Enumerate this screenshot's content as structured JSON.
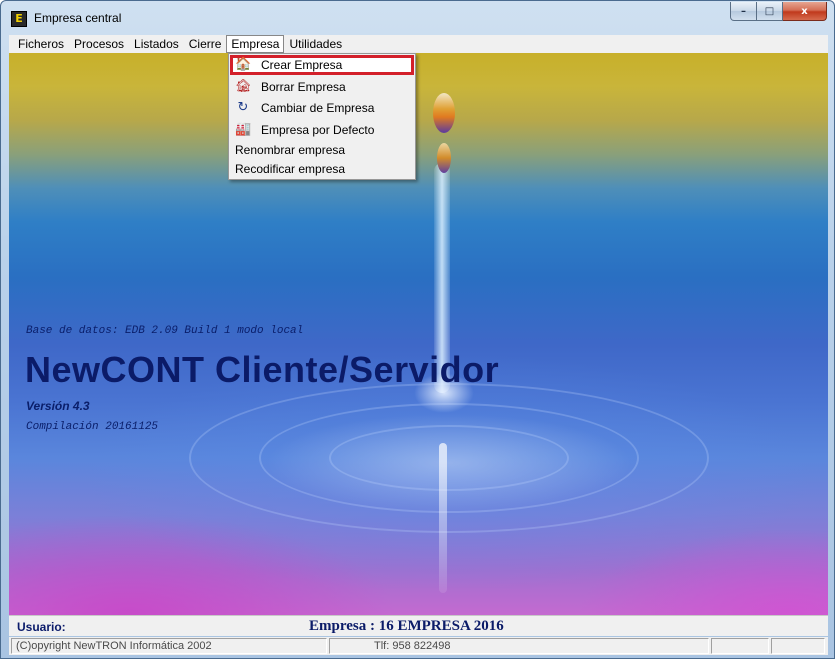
{
  "window": {
    "title": "Empresa central",
    "icon": "app-icon",
    "controls": {
      "minimize": "–",
      "maximize": "□",
      "close": "x"
    }
  },
  "menubar": {
    "items": [
      {
        "label": "Ficheros"
      },
      {
        "label": "Procesos"
      },
      {
        "label": "Listados"
      },
      {
        "label": "Cierre"
      },
      {
        "label": "Empresa"
      },
      {
        "label": "Utilidades"
      }
    ],
    "open_item": "Empresa"
  },
  "dropdown": {
    "items": [
      {
        "label": "Crear Empresa",
        "icon": "building-add-icon",
        "glyph": "🏠"
      },
      {
        "label": "Borrar Empresa",
        "icon": "building-delete-icon",
        "glyph": "🏚"
      },
      {
        "label": "Cambiar de Empresa",
        "icon": "change-icon",
        "glyph": "↻"
      },
      {
        "label": "Empresa por Defecto",
        "icon": "factory-default-icon",
        "glyph": "🏭"
      },
      {
        "label": "Renombrar empresa",
        "icon": "",
        "glyph": ""
      },
      {
        "label": "Recodificar empresa",
        "icon": "",
        "glyph": ""
      }
    ],
    "highlighted": "Crear Empresa",
    "highlight_color": "#d3202a"
  },
  "splash": {
    "db_info": "Base de datos: EDB 2.09 Build 1 modo local",
    "product_name": "NewCONT Cliente/Servidor",
    "version": "Versión 4.3",
    "build": "Compilación 20161125"
  },
  "status": {
    "user_label": "Usuario:",
    "company": "Empresa : 16 EMPRESA 2016",
    "copyright": "(C)opyright NewTRON Informática 2002",
    "phone": "Tlf: 958 822498"
  },
  "colors": {
    "brand_text": "#0b1b68",
    "menu_bg": "#f0f0f0",
    "close_button": "#c0391c"
  }
}
